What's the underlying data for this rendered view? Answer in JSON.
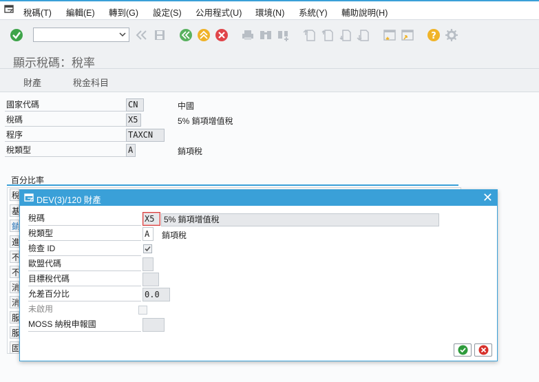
{
  "menu": {
    "items": [
      "稅碼(T)",
      "編輯(E)",
      "轉到(G)",
      "設定(S)",
      "公用程式(U)",
      "環境(N)",
      "系統(Y)",
      "輔助說明(H)"
    ]
  },
  "toolbar": {
    "command_value": "",
    "icons": [
      "enter-icon",
      "back-icon",
      "save-icon",
      "back-nav-icon",
      "exit-icon",
      "cancel-icon",
      "print-icon",
      "find-icon",
      "find-next-icon",
      "first-page-icon",
      "prev-page-icon",
      "next-page-icon",
      "last-page-icon",
      "new-session-icon",
      "shortcut-icon",
      "help-icon",
      "settings-icon"
    ]
  },
  "title": "顯示稅碼：稅率",
  "tabs": [
    "財產",
    "稅金科目"
  ],
  "header_fields": [
    {
      "label": "國家代碼",
      "value": "CN",
      "desc": "中國"
    },
    {
      "label": "稅碼",
      "value": "X5",
      "desc": "5% 銷項增值稅"
    },
    {
      "label": "程序",
      "value": "TAXCN",
      "desc": ""
    },
    {
      "label": "稅類型",
      "value": "A",
      "desc": "銷項稅"
    }
  ],
  "group": {
    "title": "百分比率",
    "rows": [
      "稅",
      "基",
      "銷",
      "進",
      "不",
      "不",
      "消",
      "消",
      "服",
      "服",
      "固"
    ]
  },
  "dialog": {
    "title": "DEV(3)/120 財產",
    "fields": {
      "tax_code_label": "稅碼",
      "tax_code_value": "X5",
      "tax_code_desc": "5% 銷項增值稅",
      "tax_type_label": "稅類型",
      "tax_type_value": "A",
      "tax_type_desc": "銷項稅",
      "check_id_label": "檢查 ID",
      "check_id_checked": true,
      "eu_code_label": "歐盟代碼",
      "eu_code_value": "",
      "target_tax_label": "目標稅代碼",
      "target_tax_value": "",
      "tolerance_label": "允差百分比",
      "tolerance_value": "0.0",
      "inactive_label": "未啟用",
      "inactive_checked": false,
      "moss_label": "MOSS 納稅申報國",
      "moss_value": ""
    }
  },
  "colors": {
    "accent": "#3aa0d8",
    "ok_green": "#2e9b3c",
    "cancel_red": "#d7312b"
  }
}
